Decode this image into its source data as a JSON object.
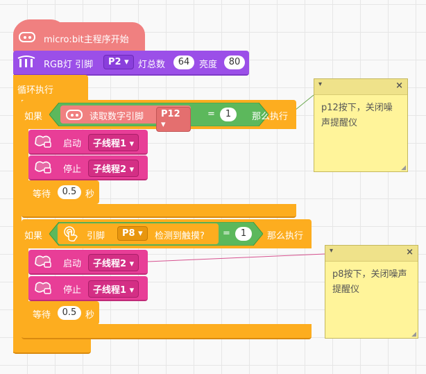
{
  "hat": {
    "label": "micro:bit主程序开始"
  },
  "rgb": {
    "label": "RGB灯 引脚",
    "pin": "P2",
    "count_label": "灯总数",
    "count": "64",
    "brightness_label": "亮度",
    "brightness": "80"
  },
  "loop": {
    "label": "循环执行"
  },
  "if1": {
    "if_label": "如果",
    "read_label": "读取数字引脚",
    "pin": "P12",
    "eq": "=",
    "value": "1",
    "then_label": "那么执行",
    "start_label": "启动",
    "start_thread": "子线程1",
    "stop_label": "停止",
    "stop_thread": "子线程2",
    "wait_label": "等待",
    "wait_value": "0.5",
    "wait_unit": "秒"
  },
  "if2": {
    "if_label": "如果",
    "pin_label": "引脚",
    "pin": "P8",
    "touch_label": "检测到触摸?",
    "eq": "=",
    "value": "1",
    "then_label": "那么执行",
    "start_label": "启动",
    "start_thread": "子线程2",
    "stop_label": "停止",
    "stop_thread": "子线程1",
    "wait_label": "等待",
    "wait_value": "0.5",
    "wait_unit": "秒"
  },
  "notes": [
    {
      "text": "p12按下，关闭噪声提醒仪"
    },
    {
      "text": "p8按下，关闭噪声提醒仪"
    }
  ],
  "icons": [
    "microbit-icon",
    "rgb-led-icon",
    "thread-start-icon",
    "thread-stop-icon",
    "touch-icon",
    "note-collapse-icon",
    "note-close-icon",
    "resize-icon"
  ],
  "colors": {
    "hat": "#f08080",
    "rgb": "#9b4fe8",
    "control": "#fdad1f",
    "condition": "#5cb85c",
    "thread": "#e83e97",
    "note": "#fff49a"
  }
}
